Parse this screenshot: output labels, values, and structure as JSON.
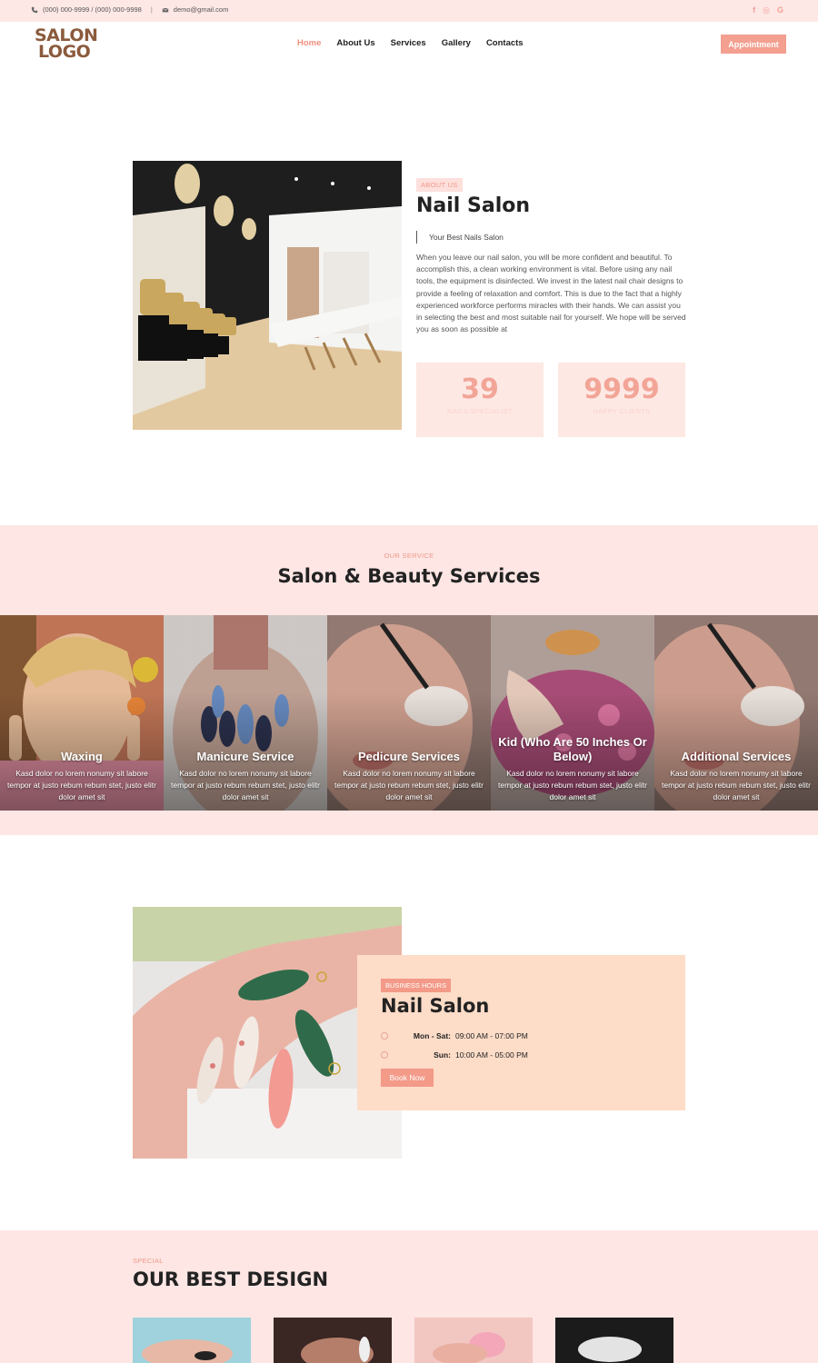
{
  "topbar": {
    "phone": "(000) 000-9999 / (000) 000-9998",
    "separator": "|",
    "email": "demo@gmail.com",
    "social": [
      "f",
      "◎",
      "G"
    ]
  },
  "header": {
    "logo_line1": "SALON",
    "logo_line2": "LOGO",
    "nav": [
      "Home",
      "About Us",
      "Services",
      "Gallery",
      "Contacts"
    ],
    "active_nav": "Home",
    "appointment_label": "Appointment"
  },
  "about": {
    "tag": "ABOUT US",
    "title": "Nail Salon",
    "subtitle": "Your Best Nails Salon",
    "body": "When you leave our nail salon, you will be more confident and beautiful. To accomplish this, a clean working environment is vital. Before using any nail tools, the equipment is disinfected. We invest in the latest nail chair designs to provide a feeling of relaxation and comfort. This is due to the fact that a highly experienced workforce performs miracles with their hands. We can assist you in selecting the best and most suitable nail for yourself. We hope will be served you as soon as possible at",
    "stats": [
      {
        "num": "39",
        "label": "NAILS SPECIALIST"
      },
      {
        "num": "9999",
        "label": "HAPPY CLIENTS"
      }
    ]
  },
  "services": {
    "eyebrow": "OUR SERVICE",
    "title": "Salon & Beauty Services",
    "items": [
      {
        "name": "Waxing",
        "desc": "Kasd dolor no lorem nonumy sit labore tempor at justo rebum rebum stet, justo elitr dolor amet sit"
      },
      {
        "name": "Manicure Service",
        "desc": "Kasd dolor no lorem nonumy sit labore tempor at justo rebum rebum stet, justo elitr dolor amet sit"
      },
      {
        "name": "Pedicure Services",
        "desc": "Kasd dolor no lorem nonumy sit labore tempor at justo rebum rebum stet, justo elitr dolor amet sit"
      },
      {
        "name": "Kid (Who Are 50 Inches Or Below)",
        "desc": "Kasd dolor no lorem nonumy sit labore tempor at justo rebum rebum stet, justo elitr dolor amet sit"
      },
      {
        "name": "Additional Services",
        "desc": "Kasd dolor no lorem nonumy sit labore tempor at justo rebum rebum stet, justo elitr dolor amet sit"
      }
    ]
  },
  "hours": {
    "tag": "BUSINESS HOURS",
    "title": "Nail Salon",
    "rows": [
      {
        "day": "Mon - Sat:",
        "time": "09:00 AM - 07:00 PM"
      },
      {
        "day": "Sun:",
        "time": "10:00 AM - 05:00 PM"
      }
    ],
    "book_label": "Book Now"
  },
  "design": {
    "eyebrow": "SPECIAL",
    "title": "OUR BEST DESIGN"
  },
  "colors": {
    "accent": "#f3a090",
    "pink_bg": "#fde6e4",
    "peach_box": "#fddcc8",
    "logo": "#8b5a3c"
  }
}
